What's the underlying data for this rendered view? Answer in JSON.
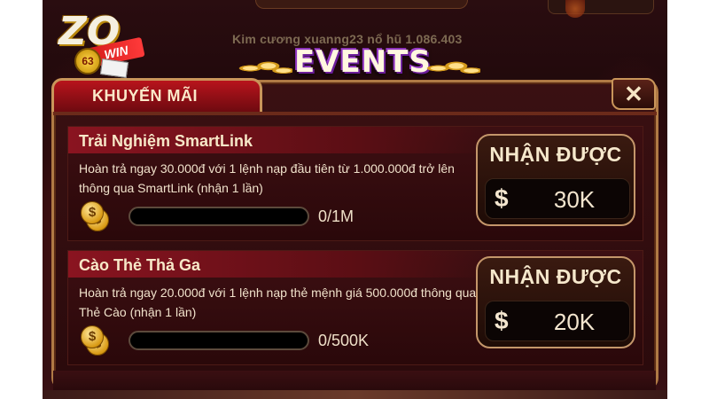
{
  "marquee_text": "Kim cương xuanng23 nổ hũ 1.086.403",
  "logo": {
    "brand": "ZO",
    "ribbon": "WIN",
    "number": "63"
  },
  "events_title": "EVENTS",
  "panel": {
    "title": "KHUYẾN MÃI",
    "close_glyph": "✕"
  },
  "promotions": [
    {
      "title": "Trải Nghiệm SmartLink",
      "description": "Hoàn trả ngay 30.000đ với 1 lệnh nạp đầu tiên từ 1.000.000đ trở lên thông qua SmartLink (nhận 1 lần)",
      "progress_text": "0/1M",
      "progress_fraction": 0,
      "reward_label": "NHẬN ĐƯỢC",
      "currency_symbol": "$",
      "reward_amount": "30K"
    },
    {
      "title": "Cào Thẻ Thả Ga",
      "description": "Hoàn trả ngay 20.000đ với 1 lệnh nạp thẻ mệnh giá 500.000đ thông qua Thẻ Cào (nhận 1 lần)",
      "progress_text": "0/500K",
      "progress_fraction": 0,
      "reward_label": "NHẬN ĐƯỢC",
      "currency_symbol": "$",
      "reward_amount": "20K"
    }
  ],
  "icons": {
    "coin": "coin-stack-icon",
    "close": "close-icon"
  },
  "colors": {
    "accent_gold": "#c9955a",
    "header_red": "#b8141c",
    "progress_track": "#000000"
  }
}
